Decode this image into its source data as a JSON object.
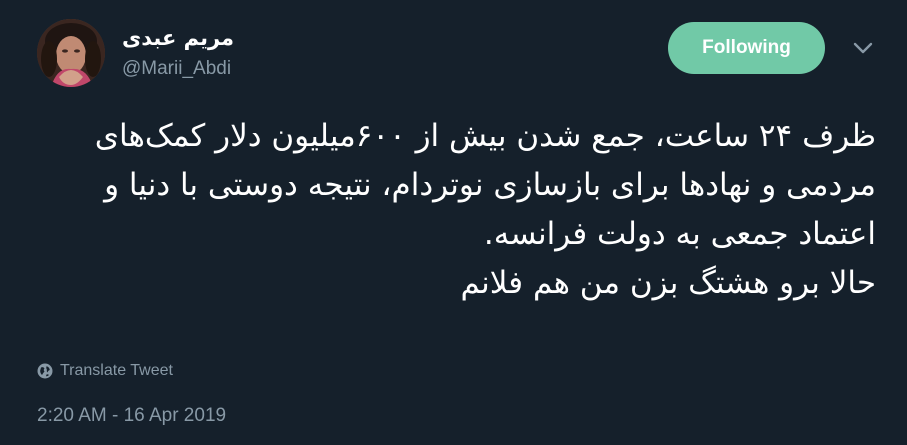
{
  "user": {
    "display_name": "مریم عبدی",
    "handle": "@Marii_Abdi"
  },
  "follow_button": {
    "label": "Following"
  },
  "menu_caret_icon": "chevron-down-icon",
  "tweet": {
    "text": "ظرف ۲۴ ساعت، جمع شدن بیش از ۶۰۰میلیون دلار کمک‌های مردمی و نهادها برای بازسازی نوتردام، نتیجه دوستی با دنیا و اعتماد جمعی به دولت فرانسه.\nحالا برو هشتگ بزن من هم فلانم",
    "translate_label": "Translate Tweet",
    "timestamp": "2:20 AM - 16 Apr 2019"
  },
  "colors": {
    "background": "#15202b",
    "text": "#ffffff",
    "secondary": "#8899a6",
    "follow_button": "#71c9a7"
  }
}
